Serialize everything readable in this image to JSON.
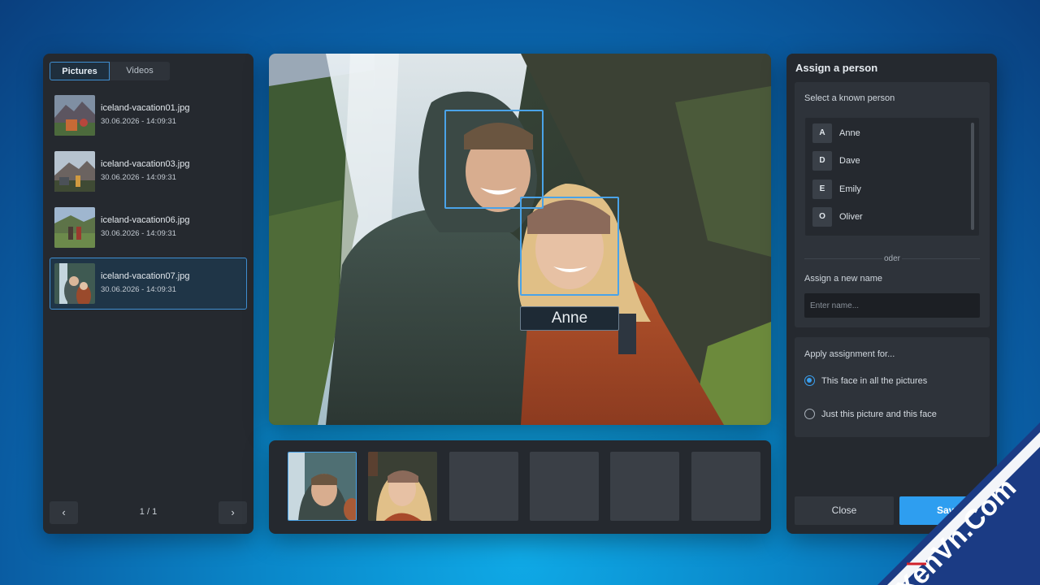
{
  "left_panel": {
    "tabs": [
      {
        "label": "Pictures",
        "active": true
      },
      {
        "label": "Videos",
        "active": false
      }
    ],
    "files": [
      {
        "name": "iceland-vacation01.jpg",
        "date": "30.06.2026 - 14:09:31",
        "selected": false
      },
      {
        "name": "iceland-vacation03.jpg",
        "date": "30.06.2026 - 14:09:31",
        "selected": false
      },
      {
        "name": "iceland-vacation06.jpg",
        "date": "30.06.2026 - 14:09:31",
        "selected": false
      },
      {
        "name": "iceland-vacation07.jpg",
        "date": "30.06.2026 - 14:09:31",
        "selected": true
      }
    ],
    "pager": {
      "prev": "‹",
      "next": "›",
      "text": "1 / 1"
    }
  },
  "photo": {
    "face_label": "Anne"
  },
  "right_panel": {
    "title": "Assign a person",
    "known_person_label": "Select a known person",
    "persons": [
      {
        "initial": "A",
        "name": "Anne"
      },
      {
        "initial": "D",
        "name": "Dave"
      },
      {
        "initial": "E",
        "name": "Emily"
      },
      {
        "initial": "O",
        "name": "Oliver"
      }
    ],
    "separator": "oder",
    "new_name_label": "Assign a new name",
    "new_name_placeholder": "Enter name...",
    "apply_label": "Apply assignment for...",
    "options": [
      {
        "label": "This face in all the pictures",
        "checked": true
      },
      {
        "label": "Just this picture and this face",
        "checked": false
      }
    ],
    "close_label": "Close",
    "save_label": "Save"
  },
  "watermark": {
    "text": "XenVn.Com"
  },
  "colors": {
    "accent": "#2e9ef0",
    "panel": "#25292f",
    "face_box": "#4aa3e8"
  }
}
